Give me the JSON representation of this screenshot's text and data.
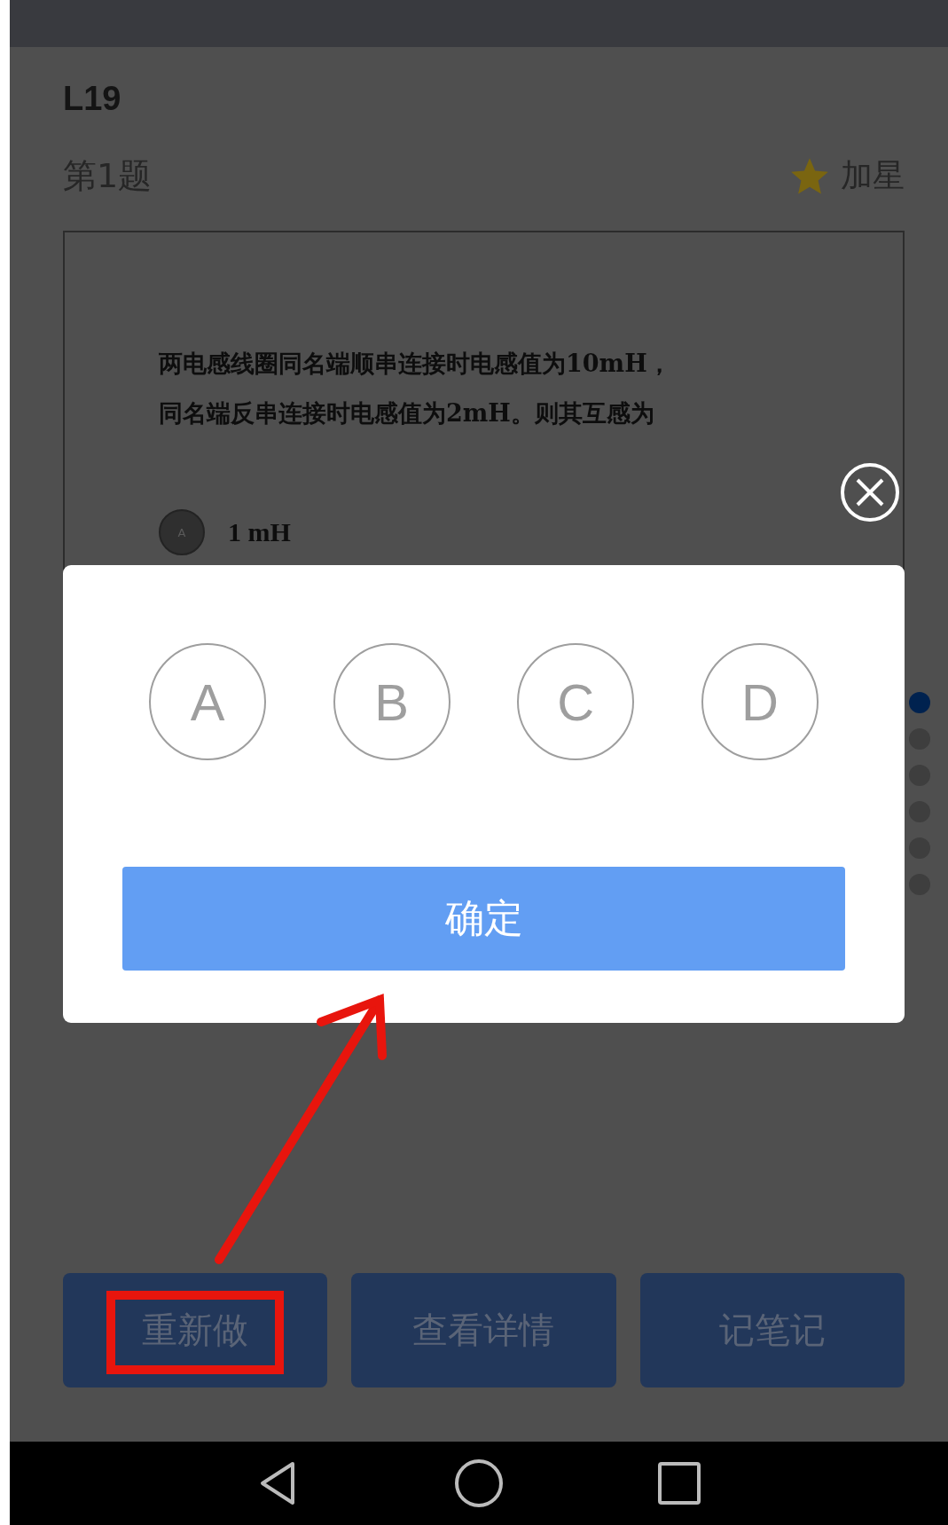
{
  "header": {
    "lesson": "L19",
    "question_number": "第1题",
    "star_label": "加星"
  },
  "question": {
    "lines": [
      "两电感线圈同名端顺串连接时电感值为10mH，",
      "同名端反串连接时电感值为2mH。则其互感为"
    ],
    "options": [
      {
        "letter": "A",
        "text": "1 mH"
      }
    ]
  },
  "page_dots": [
    {
      "selected": true
    },
    {
      "selected": false
    },
    {
      "selected": false
    },
    {
      "selected": false
    },
    {
      "selected": false
    },
    {
      "selected": false
    }
  ],
  "answer_dialog": {
    "choices": [
      {
        "label": "A",
        "selected": false
      },
      {
        "label": "B",
        "selected": false
      },
      {
        "label": "C",
        "selected": false
      },
      {
        "label": "D",
        "selected": false
      }
    ],
    "confirm": "确定"
  },
  "actions": [
    "重新做",
    "查看详情",
    "记笔记"
  ]
}
